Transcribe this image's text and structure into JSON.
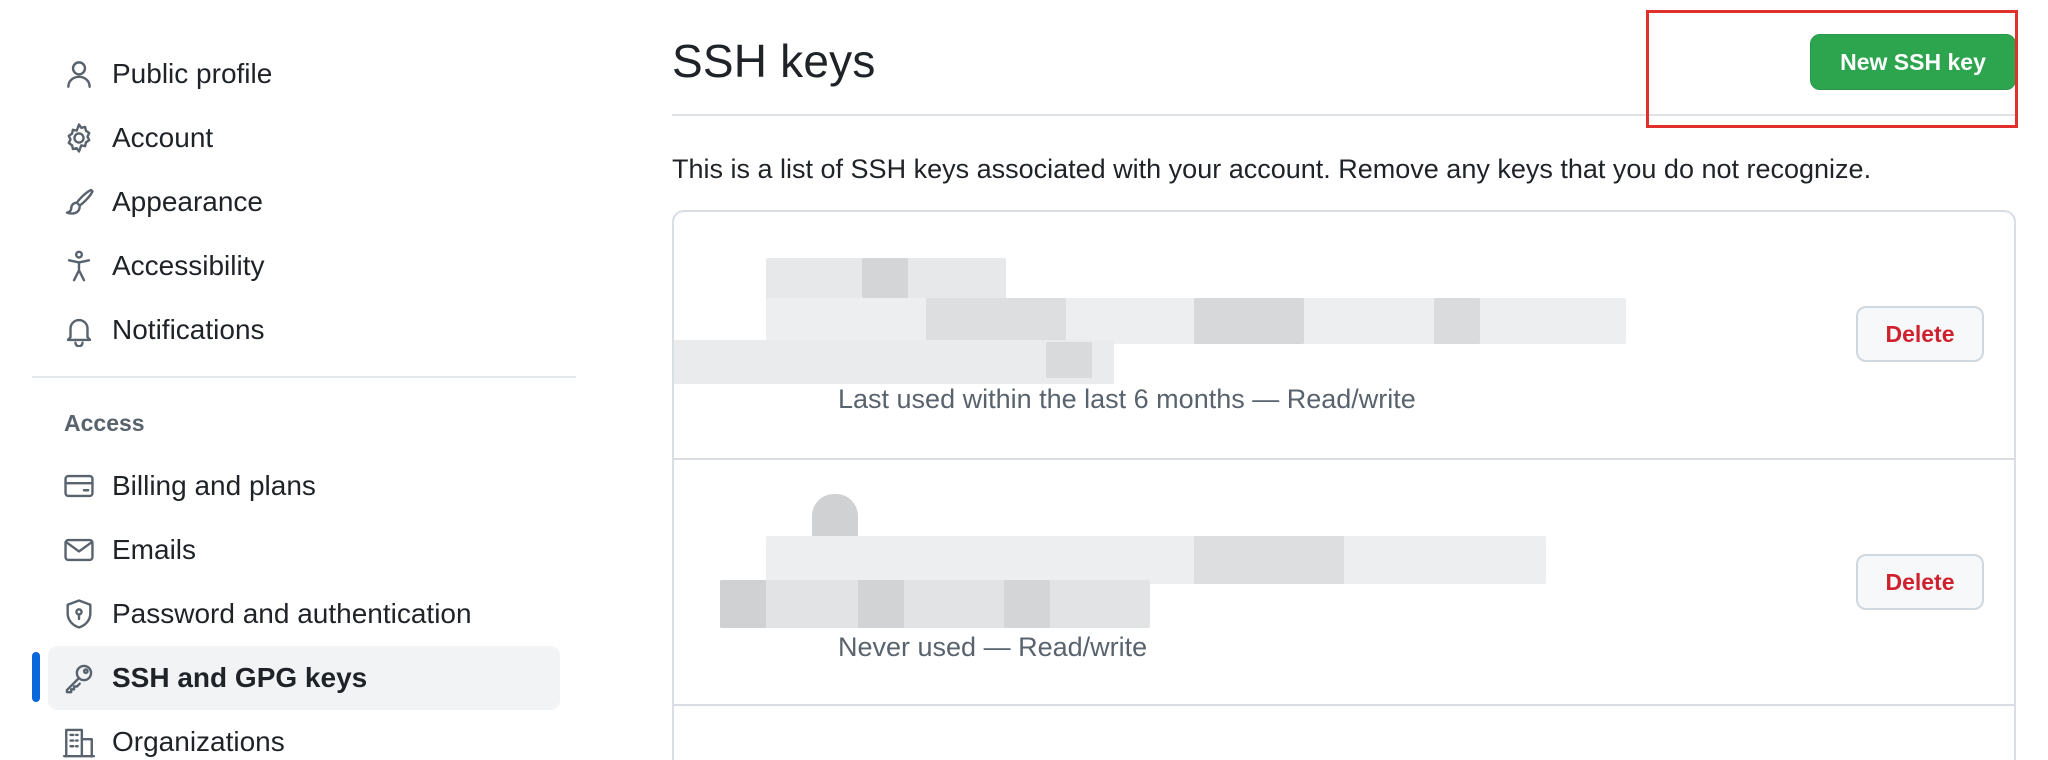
{
  "sidebar": {
    "items": [
      {
        "label": "Public profile",
        "icon": "person-icon"
      },
      {
        "label": "Account",
        "icon": "gear-icon"
      },
      {
        "label": "Appearance",
        "icon": "paintbrush-icon"
      },
      {
        "label": "Accessibility",
        "icon": "accessibility-icon"
      },
      {
        "label": "Notifications",
        "icon": "bell-icon"
      }
    ],
    "access_heading": "Access",
    "access_items": [
      {
        "label": "Billing and plans",
        "icon": "credit-card-icon"
      },
      {
        "label": "Emails",
        "icon": "mail-icon"
      },
      {
        "label": "Password and authentication",
        "icon": "shield-lock-icon"
      },
      {
        "label": "SSH and GPG keys",
        "icon": "key-icon",
        "active": true
      },
      {
        "label": "Organizations",
        "icon": "organization-icon"
      }
    ]
  },
  "main": {
    "title": "SSH keys",
    "new_key_button": "New SSH key",
    "description": "This is a list of SSH keys associated with your account. Remove any keys that you do not recognize.",
    "keys": [
      {
        "usage": "Last used within the last 6 months — Read/write",
        "delete_label": "Delete"
      },
      {
        "usage": "Never used — Read/write",
        "delete_label": "Delete"
      }
    ]
  },
  "colors": {
    "accent_blue": "#0969da",
    "primary_green": "#2da44e",
    "danger_red": "#cf222e",
    "highlight_red": "#e0302c"
  }
}
